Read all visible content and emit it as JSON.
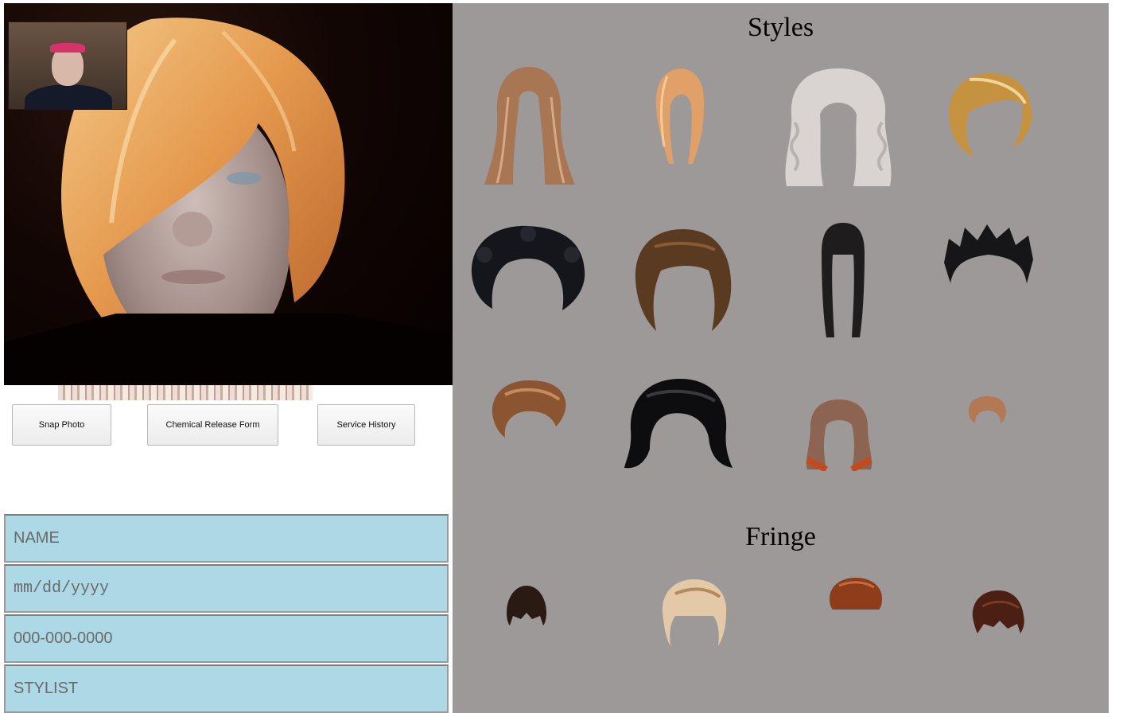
{
  "buttons": {
    "snap": "Snap Photo",
    "chemical": "Chemical Release Form",
    "history": "Service History"
  },
  "form": {
    "name_placeholder": "NAME",
    "date_placeholder": "mm/dd/yyyy",
    "phone_placeholder": "000-000-0000",
    "stylist_placeholder": "STYLIST"
  },
  "gallery": {
    "styles_title": "Styles",
    "fringe_title": "Fringe"
  },
  "colors": {
    "gallery_bg": "#9e9999",
    "field_bg": "#add8e6"
  }
}
